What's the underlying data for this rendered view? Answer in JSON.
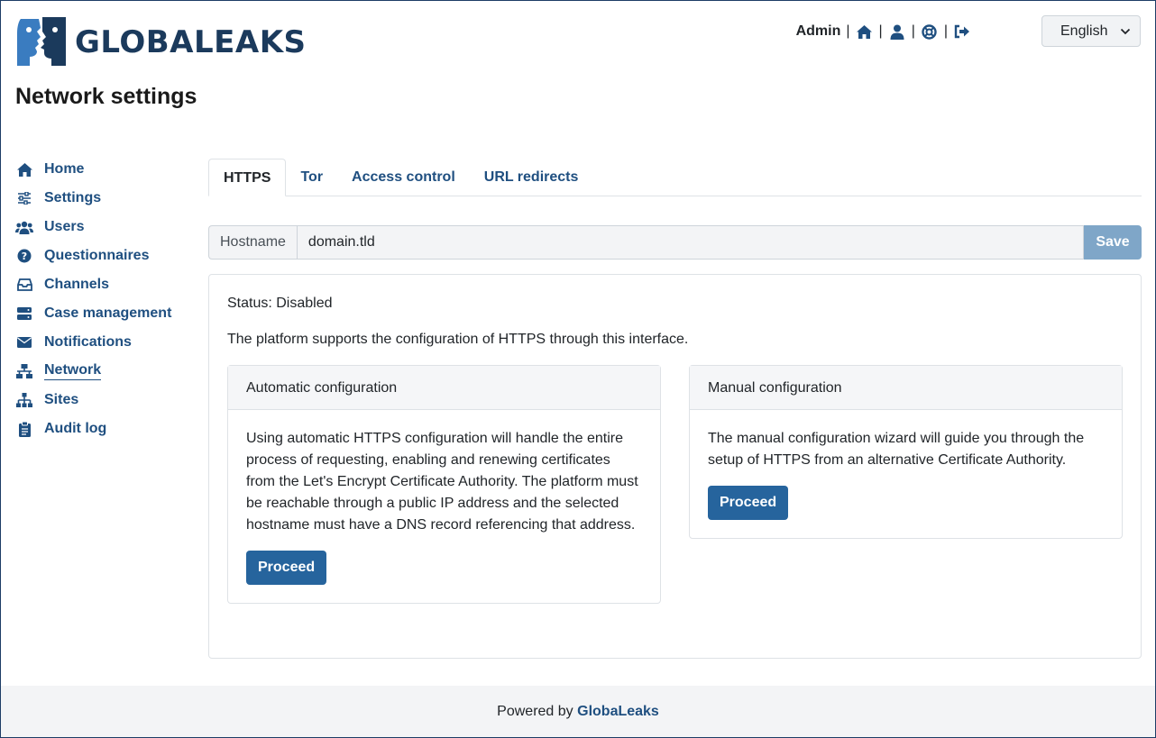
{
  "header": {
    "logo_text": "GLOBALEAKS",
    "user": "Admin",
    "language": "English",
    "icons": [
      "home-icon",
      "user-icon",
      "support-icon",
      "logout-icon"
    ]
  },
  "page": {
    "title": "Network settings"
  },
  "sidebar": {
    "items": [
      {
        "label": "Home",
        "icon": "home-icon"
      },
      {
        "label": "Settings",
        "icon": "sliders-icon"
      },
      {
        "label": "Users",
        "icon": "users-icon"
      },
      {
        "label": "Questionnaires",
        "icon": "question-icon"
      },
      {
        "label": "Channels",
        "icon": "inbox-icon"
      },
      {
        "label": "Case management",
        "icon": "server-icon"
      },
      {
        "label": "Notifications",
        "icon": "envelope-icon"
      },
      {
        "label": "Network",
        "icon": "network-icon",
        "active": true
      },
      {
        "label": "Sites",
        "icon": "sitemap-icon"
      },
      {
        "label": "Audit log",
        "icon": "clipboard-icon"
      }
    ]
  },
  "tabs": [
    {
      "label": "HTTPS",
      "active": true
    },
    {
      "label": "Tor"
    },
    {
      "label": "Access control"
    },
    {
      "label": "URL redirects"
    }
  ],
  "hostname": {
    "label": "Hostname",
    "value": "domain.tld",
    "save_label": "Save"
  },
  "https": {
    "status": "Status: Disabled",
    "intro": "The platform supports the configuration of HTTPS through this interface.",
    "automatic": {
      "title": "Automatic configuration",
      "body": "Using automatic HTTPS configuration will handle the entire process of requesting, enabling and renewing certificates from the Let's Encrypt Certificate Authority. The platform must be reachable through a public IP address and the selected hostname must have a DNS record referencing that address.",
      "button": "Proceed"
    },
    "manual": {
      "title": "Manual configuration",
      "body": "The manual configuration wizard will guide you through the setup of HTTPS from an alternative Certificate Authority.",
      "button": "Proceed"
    }
  },
  "footer": {
    "prefix": "Powered by",
    "brand": "GlobaLeaks"
  },
  "colors": {
    "primary": "#26649d",
    "nav": "#1f4f80",
    "logo": "#1b3a5c",
    "save_disabled": "#7fa6c8"
  }
}
